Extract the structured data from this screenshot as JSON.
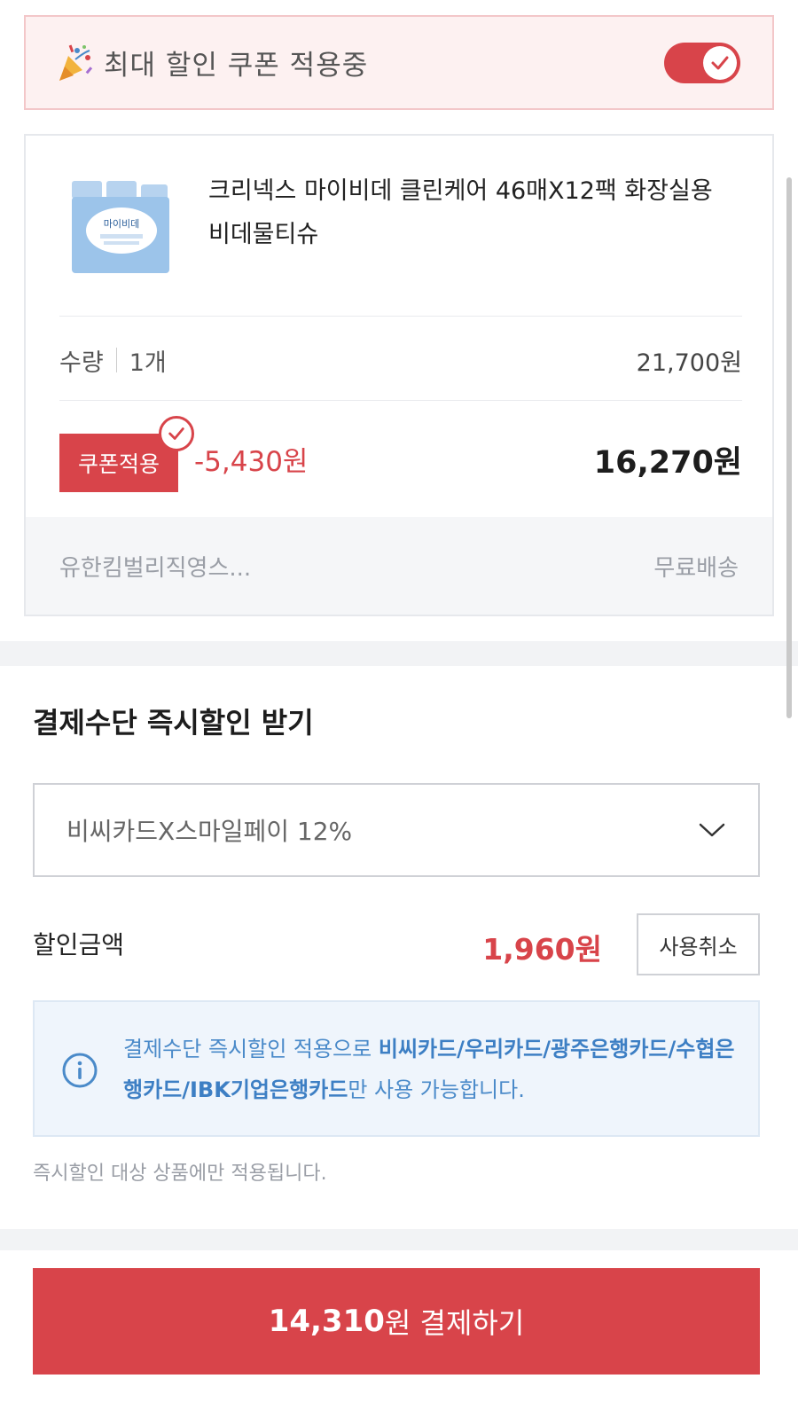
{
  "coupon_banner": {
    "label": "최대 할인 쿠폰 적용중",
    "toggle_on": true
  },
  "product": {
    "name": "크리넥스 마이비데 클린케어 46매X12팩 화장실용 비데물티슈",
    "thumbnail_text": "마이비데",
    "quantity_label": "수량",
    "quantity_value": "1개",
    "original_price": "21,700원",
    "coupon_badge": "쿠폰적용",
    "coupon_discount": "-5,430원",
    "final_price": "16,270원",
    "seller": "유한킴벌리직영스...",
    "shipping": "무료배송"
  },
  "payment_discount": {
    "title": "결제수단 즉시할인 받기",
    "selected_option": "비씨카드X스마일페이 12%",
    "discount_label": "할인금액",
    "discount_amount": "1,960원",
    "cancel_label": "사용취소",
    "info_prefix": "결제수단 즉시할인 적용으로 ",
    "info_cards": "비씨카드/우리카드/광주은행카드/수협은행카드/IBK기업은행카드",
    "info_suffix": "만 사용 가능합니다.",
    "note": "즉시할인 대상 상품에만 적용됩니다."
  },
  "checkout": {
    "amount": "14,310",
    "label": "원 결제하기"
  },
  "colors": {
    "accent": "#d8444a",
    "info": "#4a8ac9",
    "banner_bg": "#fdf1f1"
  }
}
